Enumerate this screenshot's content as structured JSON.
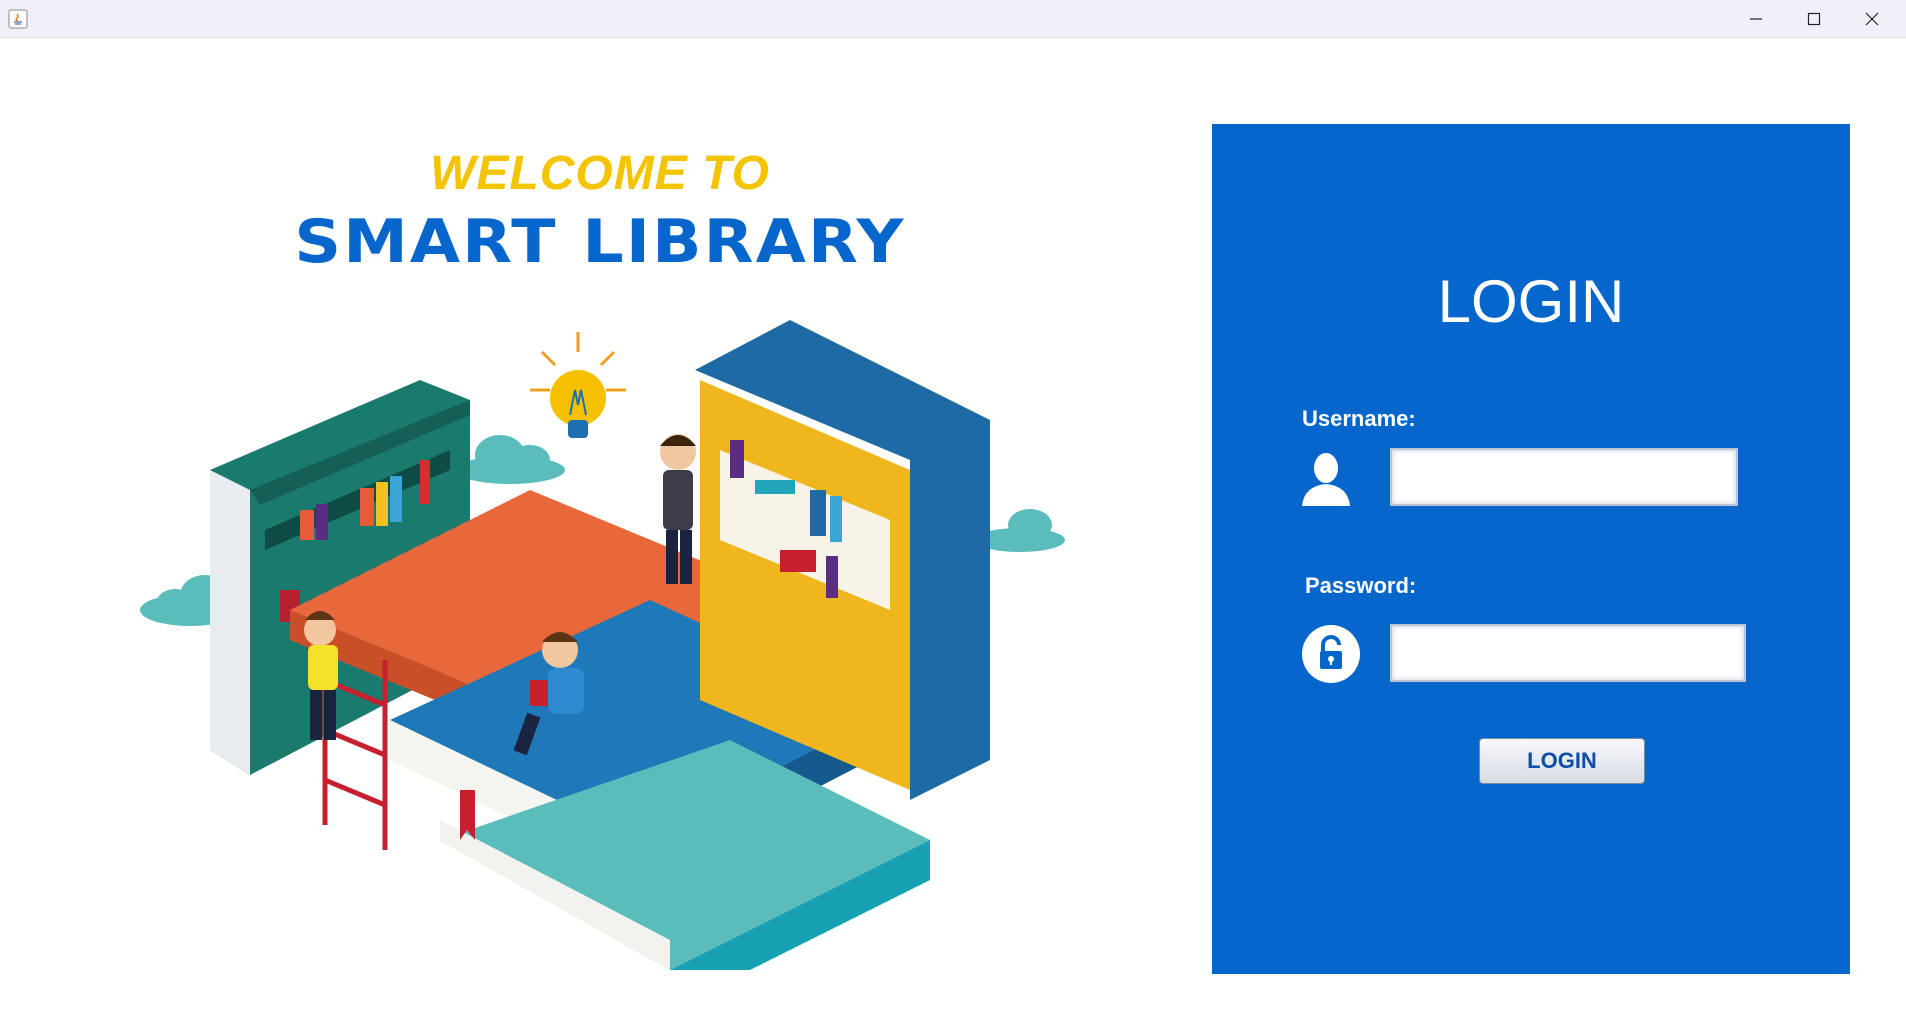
{
  "window": {
    "controls": [
      "minimize-icon",
      "maximize-icon",
      "close-icon"
    ]
  },
  "heading": {
    "welcome": "WELCOME TO",
    "brand": "SMART LIBRARY"
  },
  "login": {
    "title": "LOGIN",
    "username_label": "Username:",
    "username_value": "",
    "password_label": "Password:",
    "password_value": "",
    "button_label": "LOGIN"
  },
  "colors": {
    "panel": "#0766cc",
    "welcome": "#f5c400",
    "brand": "#0766cc"
  }
}
